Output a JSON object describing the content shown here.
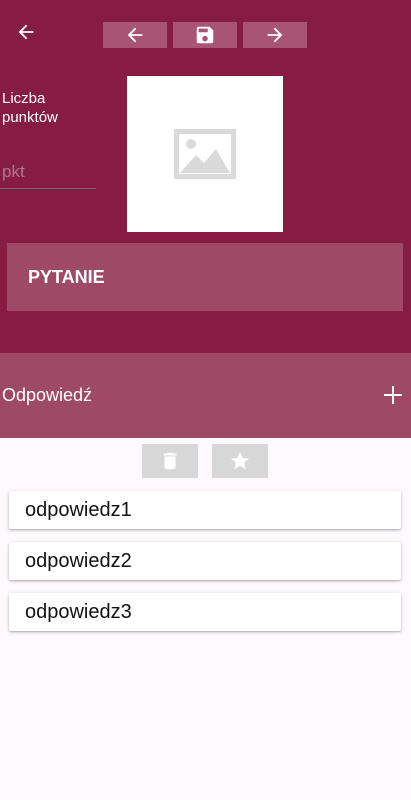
{
  "header": {
    "back_icon": "arrow-left-icon",
    "nav": {
      "prev_icon": "arrow-left-icon",
      "save_icon": "floppy-disk-icon",
      "next_icon": "arrow-right-icon"
    }
  },
  "points": {
    "label": "Liczba punktów",
    "placeholder": "pkt",
    "value": ""
  },
  "image": {
    "icon": "image-placeholder-icon"
  },
  "question": {
    "label": "PYTANIE"
  },
  "answers_section": {
    "label": "Odpowiedź",
    "add_icon": "plus-icon"
  },
  "actions": {
    "delete_icon": "trash-icon",
    "star_icon": "star-icon"
  },
  "answers": [
    {
      "text": "odpowiedz1"
    },
    {
      "text": "odpowiedz2"
    },
    {
      "text": "odpowiedz3"
    }
  ],
  "colors": {
    "primary": "#871c42",
    "primary_light": "#9e4a67",
    "nav_button": "#a85474",
    "action_button": "#d7d7d7",
    "background": "#fdf9fc"
  }
}
